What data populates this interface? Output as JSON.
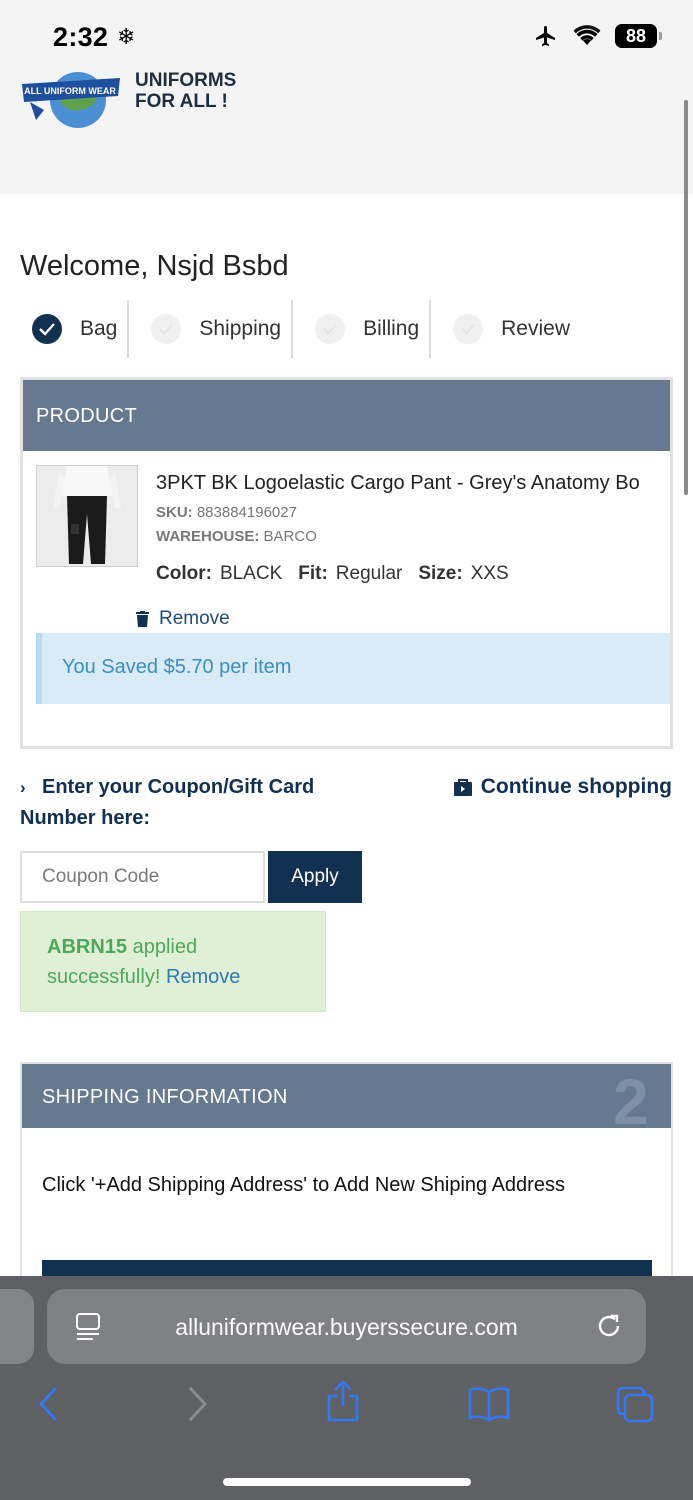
{
  "status_bar": {
    "time": "2:32",
    "battery": "88"
  },
  "header": {
    "logo_text": "ALL UNIFORM WEAR",
    "brand_line1": "UNIFORMS",
    "brand_line2": "FOR ALL !"
  },
  "welcome": "Welcome, Nsjd Bsbd",
  "steps": [
    {
      "label": "Bag",
      "done": true
    },
    {
      "label": "Shipping",
      "done": false
    },
    {
      "label": "Billing",
      "done": false
    },
    {
      "label": "Review",
      "done": false
    }
  ],
  "product_section": {
    "header": "PRODUCT",
    "title": "3PKT BK Logoelastic Cargo Pant - Grey's Anatomy Bo",
    "sku_label": "SKU:",
    "sku": "883884196027",
    "warehouse_label": "WAREHOUSE:",
    "warehouse": "BARCO",
    "color_label": "Color:",
    "color": "BLACK",
    "fit_label": "Fit:",
    "fit": "Regular",
    "size_label": "Size:",
    "size": "XXS",
    "remove_label": "Remove",
    "saved_text": "You Saved $5.70 per item"
  },
  "coupon": {
    "prompt_line1": "Enter your Coupon/Gift Card",
    "prompt_line2": "Number here:",
    "placeholder": "Coupon Code",
    "apply_label": "Apply",
    "applied_code": "ABRN15",
    "applied_text": "applied",
    "applied_text2": "successfully!",
    "remove_label": "Remove"
  },
  "continue_shopping": "Continue shopping",
  "shipping_section": {
    "header": "SHIPPING INFORMATION",
    "step_number": "2",
    "note": "Click '+Add Shipping Address' to Add New Shiping Address"
  },
  "browser": {
    "url": "alluniformwear.buyerssecure.com"
  },
  "colors": {
    "navy": "#12304f",
    "section_header": "#66798f",
    "success_bg": "#dff0d6",
    "info_bg": "#d8ebf6",
    "ios_blue": "#3478f6"
  }
}
